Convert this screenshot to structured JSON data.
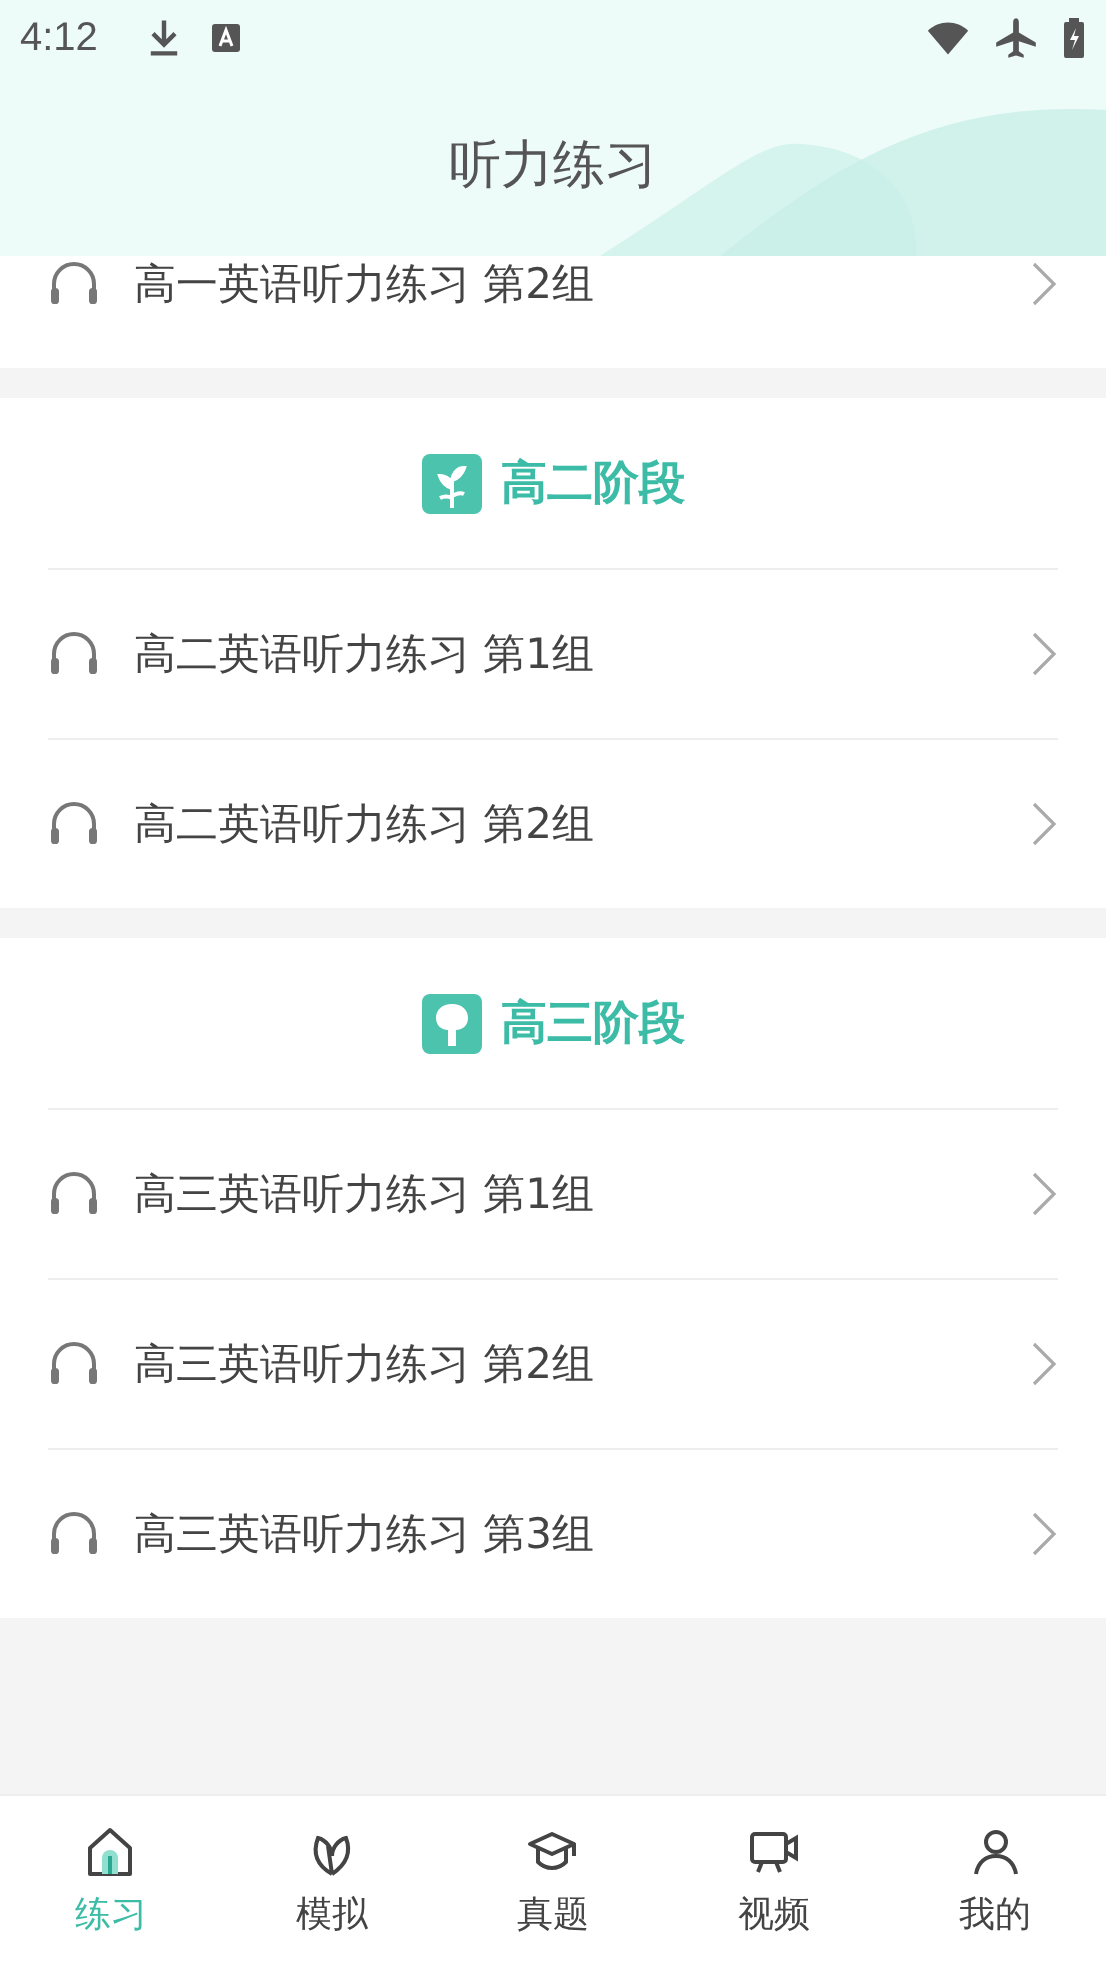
{
  "status_bar": {
    "time": "4:12"
  },
  "header": {
    "title": "听力练习"
  },
  "sections": [
    {
      "items": [
        {
          "label": "高一英语听力练习 第2组"
        }
      ]
    },
    {
      "title": "高二阶段",
      "items": [
        {
          "label": "高二英语听力练习 第1组"
        },
        {
          "label": "高二英语听力练习 第2组"
        }
      ]
    },
    {
      "title": "高三阶段",
      "items": [
        {
          "label": "高三英语听力练习 第1组"
        },
        {
          "label": "高三英语听力练习 第2组"
        },
        {
          "label": "高三英语听力练习 第3组"
        }
      ]
    }
  ],
  "tabs": [
    {
      "label": "练习",
      "selected": true
    },
    {
      "label": "模拟",
      "selected": false
    },
    {
      "label": "真题",
      "selected": false
    },
    {
      "label": "视频",
      "selected": false
    },
    {
      "label": "我的",
      "selected": false
    }
  ]
}
